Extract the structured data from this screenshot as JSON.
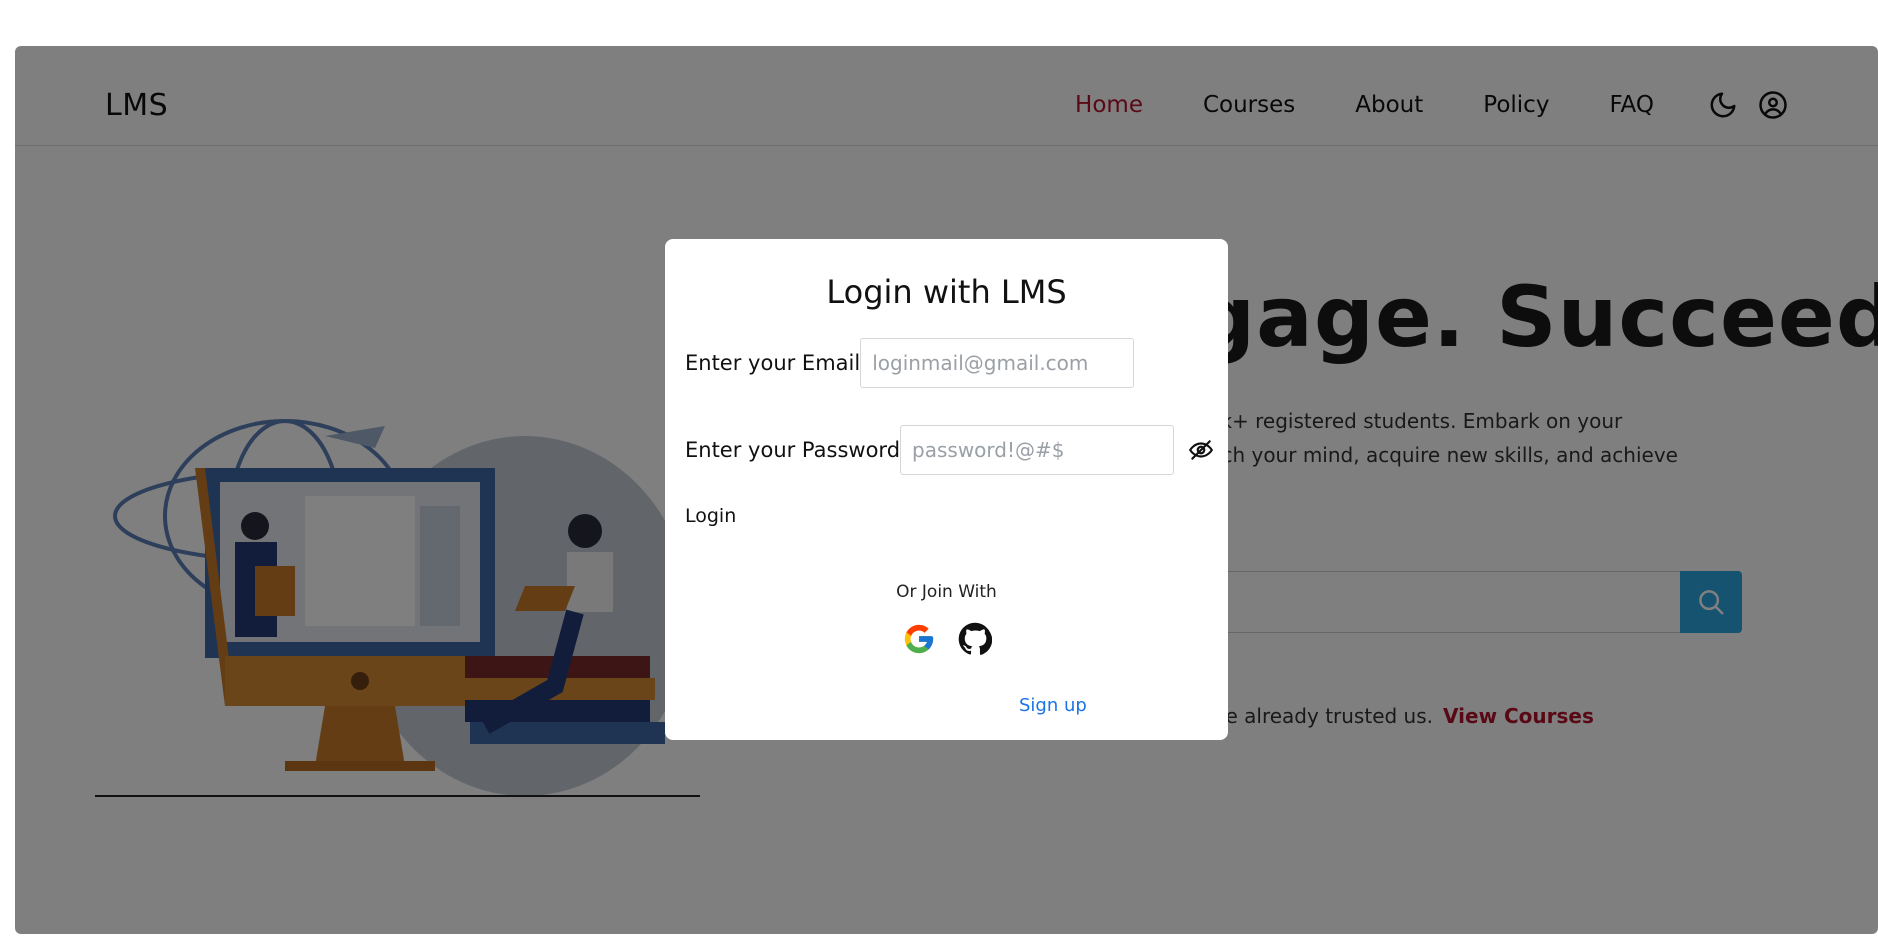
{
  "navbar": {
    "brand": "LMS",
    "items": [
      {
        "label": "Home",
        "active": true
      },
      {
        "label": "Courses",
        "active": false
      },
      {
        "label": "About",
        "active": false
      },
      {
        "label": "Policy",
        "active": false
      },
      {
        "label": "FAQ",
        "active": false
      }
    ],
    "icons": [
      "moon-icon",
      "user-circle-icon"
    ]
  },
  "hero": {
    "title_visible": "gage. Succeed.",
    "subtitle_line1": "00k+ registered students. Embark on your",
    "subtitle_line2": "nrich your mind, acquire new skills, and achieve",
    "trust_text": "ople already trusted us.",
    "view_courses": "View Courses",
    "search_icon": "search-icon"
  },
  "modal": {
    "title": "Login with LMS",
    "email_label": "Enter your Email",
    "email_placeholder": "loginmail@gmail.com",
    "password_label": "Enter your Password",
    "password_placeholder": "password!@#$",
    "eye_icon": "eye-off-icon",
    "login_label": "Login",
    "join_text": "Or Join With",
    "social_icons": [
      "google-icon",
      "github-icon"
    ],
    "signup_label": "Sign up"
  },
  "colors": {
    "accent_red": "#b3122b",
    "search_blue": "#2aa7e1",
    "link_blue": "#1a73e8",
    "overlay": "rgba(0,0,0,0.5)"
  }
}
